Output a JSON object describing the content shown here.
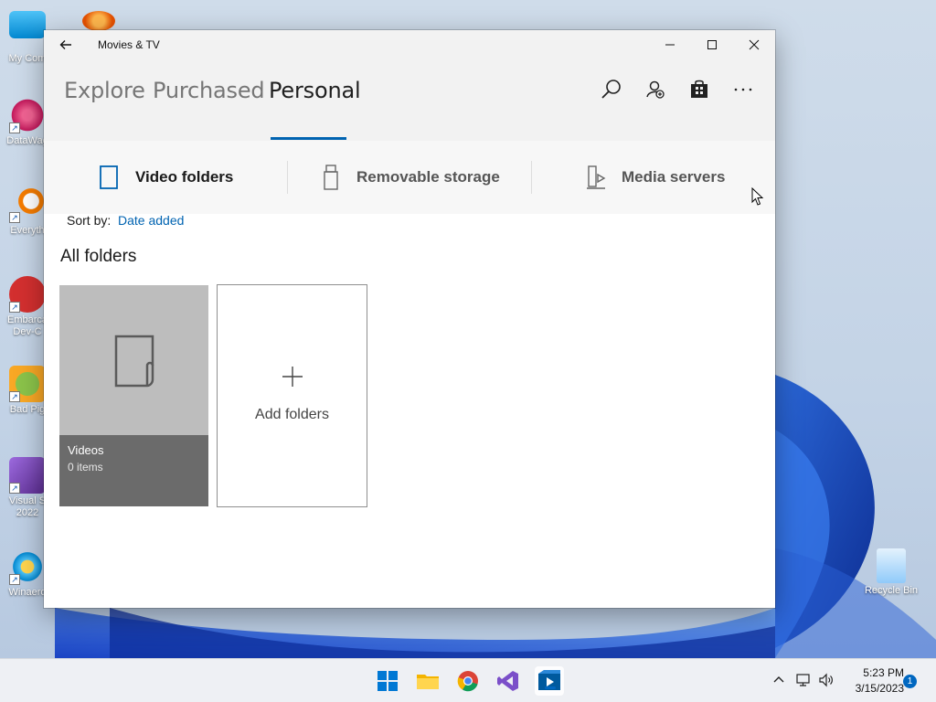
{
  "desktop": {
    "icons": [
      {
        "label": "My Com"
      },
      {
        "label": "DataWag"
      },
      {
        "label": "Everyth"
      },
      {
        "label": "Embarca",
        "label2": "Dev-C"
      },
      {
        "label": "Bad Pig"
      },
      {
        "label": "Visual S",
        "label2": "2022"
      },
      {
        "label": "Winaero"
      }
    ],
    "recycle_bin": "Recycle Bin"
  },
  "window": {
    "title": "Movies & TV",
    "nav_tabs": [
      {
        "label": "Explore"
      },
      {
        "label": "Purchased"
      },
      {
        "label": "Personal",
        "active": true
      }
    ],
    "sub_nav": [
      {
        "label": "Video folders",
        "icon": "tablet-icon",
        "active": true
      },
      {
        "label": "Removable storage",
        "icon": "usb-icon"
      },
      {
        "label": "Media servers",
        "icon": "media-server-icon"
      }
    ],
    "sort": {
      "label": "Sort by:",
      "value": "Date added"
    },
    "section_title": "All folders",
    "folders": [
      {
        "name": "Videos",
        "count": "0 items"
      }
    ],
    "add_folders_label": "Add folders"
  },
  "taskbar": {
    "time": "5:23 PM",
    "date": "3/15/2023",
    "notification_count": "1"
  },
  "colors": {
    "accent": "#0063b1",
    "tile_gray": "#bdbdbd",
    "tile_caption": "#6b6b6b"
  }
}
